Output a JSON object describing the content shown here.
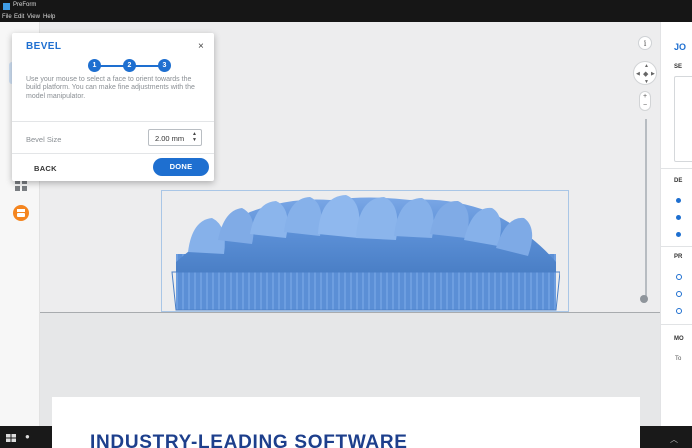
{
  "window": {
    "app_title": "PreForm"
  },
  "menu": [
    "File",
    "Edit",
    "View",
    "Help"
  ],
  "bevel_dialog": {
    "title": "BEVEL",
    "close_glyph": "×",
    "steps": [
      "1",
      "2",
      "3"
    ],
    "description": "Use your mouse to select a face to orient towards the build platform. You can make fine adjustments with the model manipulator.",
    "size_label": "Bevel Size",
    "size_value": "2.00 mm",
    "back_label": "BACK",
    "done_label": "DONE"
  },
  "viewport": {
    "info_glyph": "i"
  },
  "side_panel": {
    "heading": "JO",
    "sections": [
      "SE",
      "DE",
      "PR",
      "MO"
    ],
    "text": "To"
  },
  "banner": {
    "text": "INDUSTRY-LEADING SOFTWARE"
  },
  "icons": [
    "magic-wand-icon",
    "tooth-select-icon",
    "pencil-icon",
    "orient-icon",
    "supports-icon",
    "layout-icon",
    "printer-icon",
    "user-icon",
    "windows-icon",
    "mic-icon"
  ],
  "colors": {
    "accent": "#1e6fd0",
    "model": "#5b8fd6",
    "printer_badge": "#f4851f",
    "banner_text": "#1d3f8c"
  }
}
